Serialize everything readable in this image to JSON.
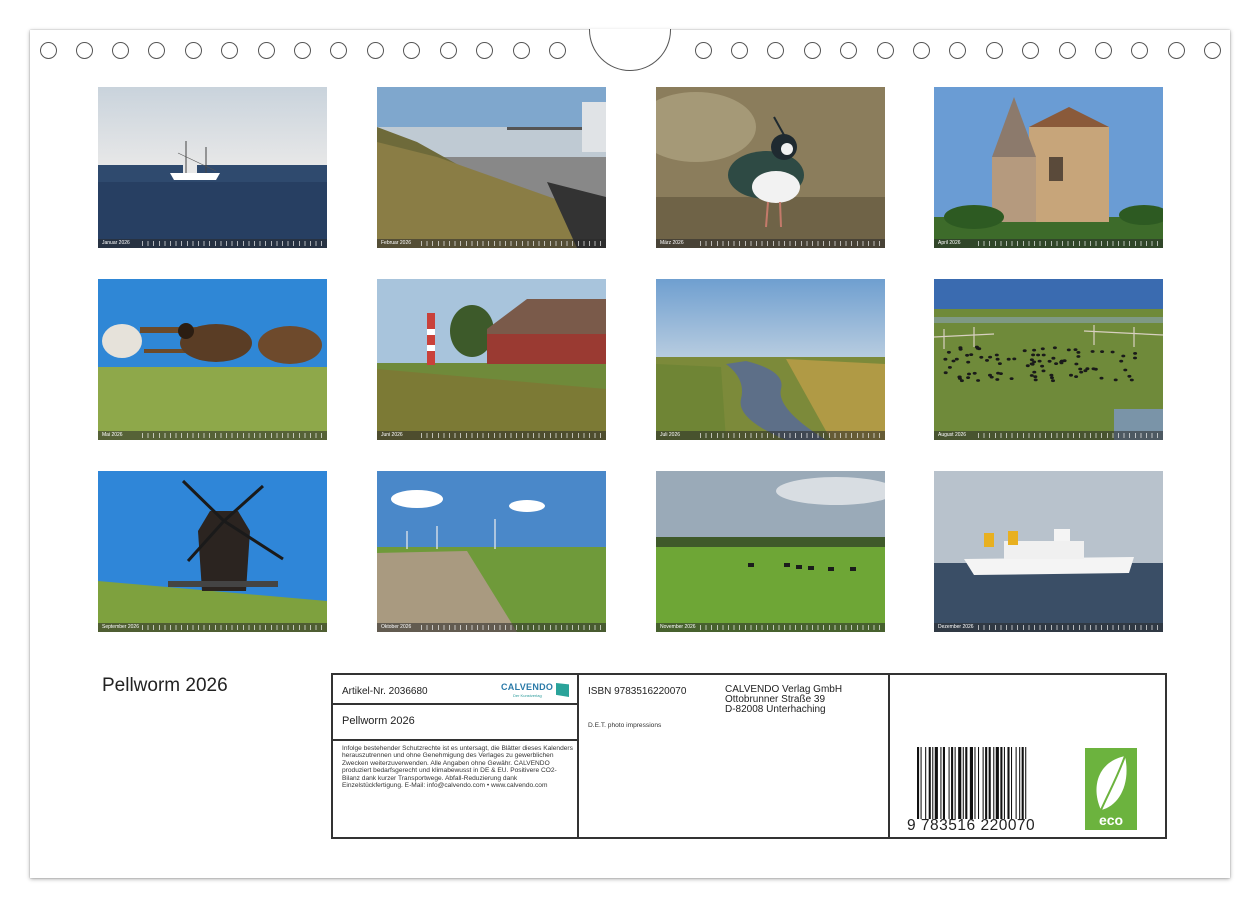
{
  "title": "Pellworm 2026",
  "months": [
    {
      "id": "jan",
      "label": "Januar 2026",
      "scene": "Fishing boat on the sea"
    },
    {
      "id": "feb",
      "label": "Februar 2026",
      "scene": "Harbour pier and dike"
    },
    {
      "id": "mar",
      "label": "März 2026",
      "scene": "Lapwing"
    },
    {
      "id": "apr",
      "label": "April 2026",
      "scene": "Church with tower"
    },
    {
      "id": "may",
      "label": "Mai 2026",
      "scene": "Sheep on the dike"
    },
    {
      "id": "jun",
      "label": "Juni 2026",
      "scene": "Lighthouse and thatched house"
    },
    {
      "id": "jul",
      "label": "Juli 2026",
      "scene": "Marsh creek"
    },
    {
      "id": "aug",
      "label": "August 2026",
      "scene": "Birds in the salt marsh"
    },
    {
      "id": "sep",
      "label": "September 2026",
      "scene": "Windmill"
    },
    {
      "id": "oct",
      "label": "Oktober 2026",
      "scene": "Dike with wind turbines"
    },
    {
      "id": "nov",
      "label": "November 2026",
      "scene": "Cattle on pasture"
    },
    {
      "id": "dec",
      "label": "Dezember 2026",
      "scene": "Ferry"
    }
  ],
  "info": {
    "artikel": "Artikel-Nr. 2036680",
    "title": "Pellworm 2026",
    "legal": "Infolge bestehender Schutzrechte ist es untersagt, die Blätter dieses Kalenders herauszutrennen und ohne Genehmigung des Verlages zu gewerblichen Zwecken weiterzuverwenden. Alle Angaben ohne Gewähr. CALVENDO produziert bedarfsgerecht und klimabewusst in DE & EU. Positivere CO2-Bilanz dank kurzer Transportwege. Abfall-Reduzierung dank Einzelstückfertigung. E-Mail: info@calvendo.com • www.calvendo.com",
    "isbn": "ISBN 9783516220070",
    "author": "D.E.T. photo impressions",
    "publisher_name": "CALVENDO Verlag GmbH",
    "publisher_street": "Ottobrunner Straße 39",
    "publisher_city": "D-82008 Unterhaching",
    "barcode_digits": "9 783516 220070",
    "logo_word": "CALVENDO",
    "logo_sub": "Der Kunstverlag",
    "eco_label": "eco"
  },
  "colors": {
    "frame": "#333333",
    "eco_green": "#6cb33e",
    "calvendo_blue": "#2a7aa8"
  }
}
